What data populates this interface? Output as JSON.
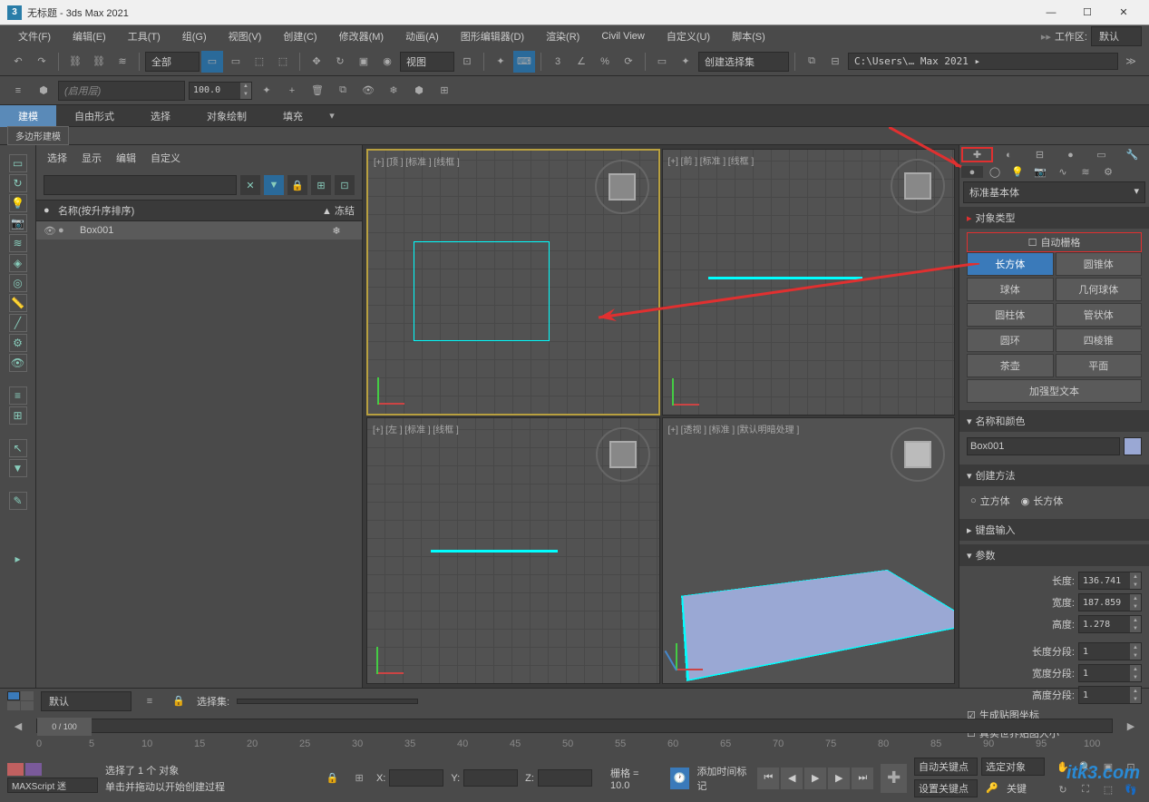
{
  "window": {
    "title": "无标题 - 3ds Max 2021",
    "app_icon": "3"
  },
  "menu": {
    "items": [
      "文件(F)",
      "编辑(E)",
      "工具(T)",
      "组(G)",
      "视图(V)",
      "创建(C)",
      "修改器(M)",
      "动画(A)",
      "图形编辑器(D)",
      "渲染(R)",
      "Civil View",
      "自定义(U)",
      "脚本(S)"
    ],
    "workspace_label": "工作区:",
    "workspace_value": "默认"
  },
  "toolbar": {
    "filter": "全部",
    "coord_sys": "视图",
    "selection_set": "创建选择集",
    "path": "C:\\Users\\… Max 2021 ▸"
  },
  "layer": {
    "placeholder": "(启用层)",
    "opacity": "100.0"
  },
  "ribbon": {
    "tabs": [
      "建模",
      "自由形式",
      "选择",
      "对象绘制",
      "填充"
    ],
    "sub": "多边形建模"
  },
  "scene": {
    "tabs": [
      "选择",
      "显示",
      "编辑",
      "自定义"
    ],
    "header_name": "名称(按升序排序)",
    "header_freeze": "▲ 冻结",
    "item": "Box001",
    "freeze_icon": "❄"
  },
  "viewports": {
    "v1": "[+] [顶 ] [标准 ] [线框 ]",
    "v2": "[+] [前 ] [标准 ] [线框 ]",
    "v3": "[+] [左 ] [标准 ] [线框 ]",
    "v4": "[+] [透视 ] [标准 ] [默认明暗处理 ]"
  },
  "cmd": {
    "category": "标准基本体",
    "rollout_obj_type": "对象类型",
    "auto_grid": "自动栅格",
    "primitives": {
      "box": "长方体",
      "cone": "圆锥体",
      "sphere": "球体",
      "geosphere": "几何球体",
      "cylinder": "圆柱体",
      "tube": "管状体",
      "torus": "圆环",
      "pyramid": "四棱锥",
      "teapot": "茶壶",
      "plane": "平面",
      "textplus": "加强型文本"
    },
    "rollout_name": "名称和颜色",
    "object_name": "Box001",
    "rollout_method": "创建方法",
    "method_cube": "立方体",
    "method_box": "长方体",
    "rollout_keyboard": "键盘输入",
    "rollout_params": "参数",
    "params": {
      "length_label": "长度:",
      "length": "136.741",
      "width_label": "宽度:",
      "width": "187.859",
      "height_label": "高度:",
      "height": "1.278",
      "lsegs_label": "长度分段:",
      "lsegs": "1",
      "wsegs_label": "宽度分段:",
      "wsegs": "1",
      "hsegs_label": "高度分段:",
      "hsegs": "1",
      "gen_uv": "生成贴图坐标",
      "real_world": "真实世界贴图大小"
    }
  },
  "bottom": {
    "layout_default": "默认",
    "selset_label": "选择集:",
    "time_pos": "0 / 100",
    "ticks": [
      "0",
      "5",
      "10",
      "15",
      "20",
      "25",
      "30",
      "35",
      "40",
      "45",
      "50",
      "55",
      "60",
      "65",
      "70",
      "75",
      "80",
      "85",
      "90",
      "95",
      "100"
    ],
    "maxscript": "MAXScript 迷",
    "status_sel": "选择了 1 个 对象",
    "status_hint": "单击并拖动以开始创建过程",
    "x": "X:",
    "y": "Y:",
    "z": "Z:",
    "grid_label": "栅格 = 10.0",
    "add_time_tag": "添加时间标记",
    "auto_key": "自动关键点",
    "set_key": "设置关键点",
    "sel_obj": "选定对象",
    "key_filter": "关键"
  },
  "watermark": "itk3.com"
}
